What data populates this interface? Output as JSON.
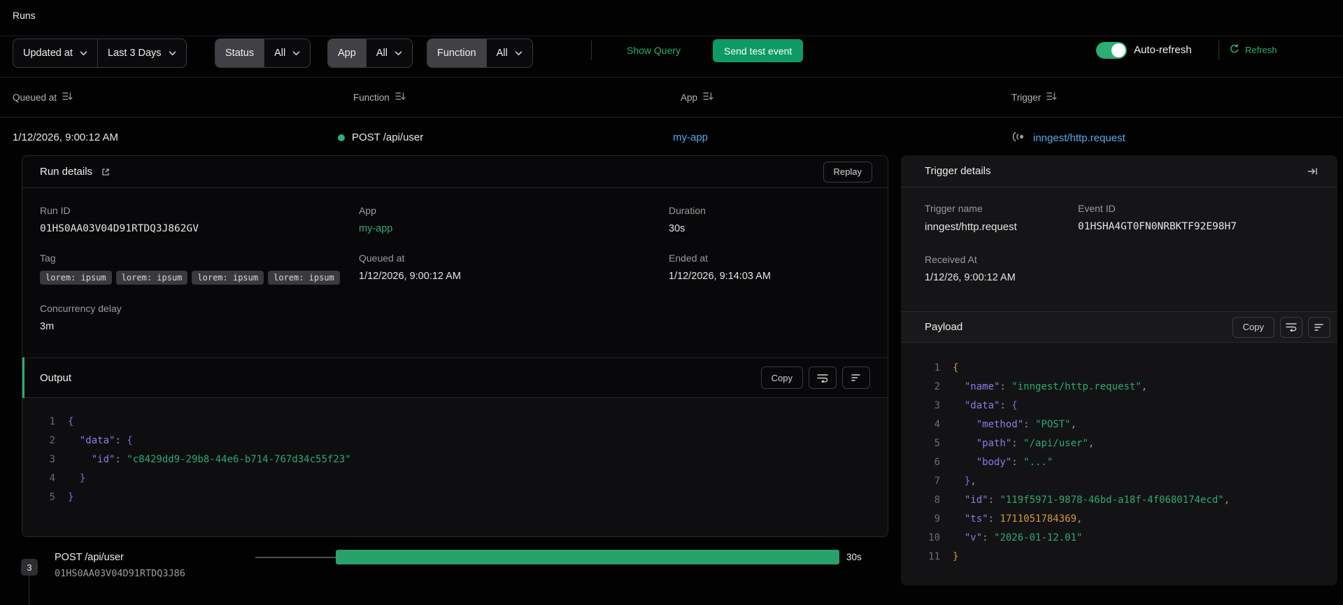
{
  "page": {
    "title": "Runs"
  },
  "toolbar": {
    "sort_select": {
      "label": "Updated at"
    },
    "range_select": {
      "label": "Last 3 Days"
    },
    "status_filter": {
      "label": "Status",
      "value": "All"
    },
    "app_filter": {
      "label": "App",
      "value": "All"
    },
    "function_filter": {
      "label": "Function",
      "value": "All"
    },
    "show_query_label": "Show Query",
    "send_test_event_label": "Send test event",
    "auto_refresh_label": "Auto-refresh",
    "refresh_label": "Refresh"
  },
  "runs_table": {
    "headers": {
      "queued_at": "Queued at",
      "function": "Function",
      "app": "App",
      "trigger": "Trigger"
    },
    "row": {
      "queued_at": "1/12/2026, 9:00:12 AM",
      "function": "POST /api/user",
      "app": "my-app",
      "trigger": "inngest/http.request"
    }
  },
  "run_details": {
    "title": "Run details",
    "replay_label": "Replay",
    "run_id": {
      "label": "Run ID",
      "value": "01HS0AA03V04D91RTDQ3J862GV"
    },
    "app": {
      "label": "App",
      "value": "my-app"
    },
    "duration": {
      "label": "Duration",
      "value": "30s"
    },
    "tag": {
      "label": "Tag",
      "badges": [
        "lorem: ipsum",
        "lorem: ipsum",
        "lorem: ipsum",
        "lorem: ipsum"
      ]
    },
    "queued_at": {
      "label": "Queued at",
      "value": "1/12/2026, 9:00:12 AM"
    },
    "ended_at": {
      "label": "Ended at",
      "value": "1/12/2026, 9:14:03 AM"
    },
    "concurrency_delay": {
      "label": "Concurrency delay",
      "value": "3m"
    },
    "output": {
      "title": "Output",
      "copy_label": "Copy",
      "code": [
        [
          {
            "t": "{",
            "c": "br-b"
          }
        ],
        [
          {
            "t": "  ",
            "c": "pun"
          },
          {
            "t": "\"data\"",
            "c": "key"
          },
          {
            "t": ": ",
            "c": "pun"
          },
          {
            "t": "{",
            "c": "br-b"
          }
        ],
        [
          {
            "t": "    ",
            "c": "pun"
          },
          {
            "t": "\"id\"",
            "c": "key"
          },
          {
            "t": ": ",
            "c": "pun"
          },
          {
            "t": "\"c8429dd9-29b8-44e6-b714-767d34c55f23\"",
            "c": "str"
          }
        ],
        [
          {
            "t": "  ",
            "c": "pun"
          },
          {
            "t": "}",
            "c": "br-b"
          }
        ],
        [
          {
            "t": "}",
            "c": "br-b"
          }
        ]
      ]
    }
  },
  "timeline": {
    "step_count": "3",
    "step_name": "POST /api/user",
    "step_run_id": "01HS0AA03V04D91RTDQ3J86",
    "duration_label": "30s"
  },
  "trigger_details": {
    "title": "Trigger details",
    "trigger_name": {
      "label": "Trigger name",
      "value": "inngest/http.request"
    },
    "event_id": {
      "label": "Event ID",
      "value": "01HSHA4GT0FN0NRBKTF92E98H7"
    },
    "received_at": {
      "label": "Received At",
      "value": "1/12/26, 9:00:12 AM"
    },
    "payload": {
      "title": "Payload",
      "copy_label": "Copy",
      "code": [
        [
          {
            "t": "{",
            "c": "br-a"
          }
        ],
        [
          {
            "t": "  ",
            "c": "pun"
          },
          {
            "t": "\"name\"",
            "c": "key"
          },
          {
            "t": ": ",
            "c": "pun"
          },
          {
            "t": "\"inngest/http.request\"",
            "c": "str"
          },
          {
            "t": ",",
            "c": "pun"
          }
        ],
        [
          {
            "t": "  ",
            "c": "pun"
          },
          {
            "t": "\"data\"",
            "c": "key"
          },
          {
            "t": ": ",
            "c": "pun"
          },
          {
            "t": "{",
            "c": "br-b"
          }
        ],
        [
          {
            "t": "    ",
            "c": "pun"
          },
          {
            "t": "\"method\"",
            "c": "key"
          },
          {
            "t": ": ",
            "c": "pun"
          },
          {
            "t": "\"POST\"",
            "c": "str"
          },
          {
            "t": ",",
            "c": "pun"
          }
        ],
        [
          {
            "t": "    ",
            "c": "pun"
          },
          {
            "t": "\"path\"",
            "c": "key"
          },
          {
            "t": ": ",
            "c": "pun"
          },
          {
            "t": "\"/api/user\"",
            "c": "str"
          },
          {
            "t": ",",
            "c": "pun"
          }
        ],
        [
          {
            "t": "    ",
            "c": "pun"
          },
          {
            "t": "\"body\"",
            "c": "key"
          },
          {
            "t": ": ",
            "c": "pun"
          },
          {
            "t": "\"...\"",
            "c": "str"
          }
        ],
        [
          {
            "t": "  ",
            "c": "pun"
          },
          {
            "t": "}",
            "c": "br-b"
          },
          {
            "t": ",",
            "c": "pun"
          }
        ],
        [
          {
            "t": "  ",
            "c": "pun"
          },
          {
            "t": "\"id\"",
            "c": "key"
          },
          {
            "t": ": ",
            "c": "pun"
          },
          {
            "t": "\"119f5971-9878-46bd-a18f-4f0680174ecd\"",
            "c": "str"
          },
          {
            "t": ",",
            "c": "pun"
          }
        ],
        [
          {
            "t": "  ",
            "c": "pun"
          },
          {
            "t": "\"ts\"",
            "c": "key"
          },
          {
            "t": ": ",
            "c": "pun"
          },
          {
            "t": "1711051784369",
            "c": "num"
          },
          {
            "t": ",",
            "c": "pun"
          }
        ],
        [
          {
            "t": "  ",
            "c": "pun"
          },
          {
            "t": "\"v\"",
            "c": "key"
          },
          {
            "t": ": ",
            "c": "pun"
          },
          {
            "t": "\"2026-01-12.01\"",
            "c": "str"
          }
        ],
        [
          {
            "t": "}",
            "c": "br-a"
          }
        ]
      ]
    }
  },
  "colors": {
    "accent_green": "#2cae72",
    "button_green": "#0d9a64",
    "link_blue": "#5aa9e6",
    "status_dot": "#2cae72",
    "timeline_bar": "#2aa06a",
    "code_key": "#8b7ce8",
    "code_string": "#2fa874",
    "code_number": "#d19a3a",
    "code_brace_alt": "#7d6fe0",
    "code_punct": "#9a9a9a",
    "code_linenum": "#6e6e6e"
  }
}
